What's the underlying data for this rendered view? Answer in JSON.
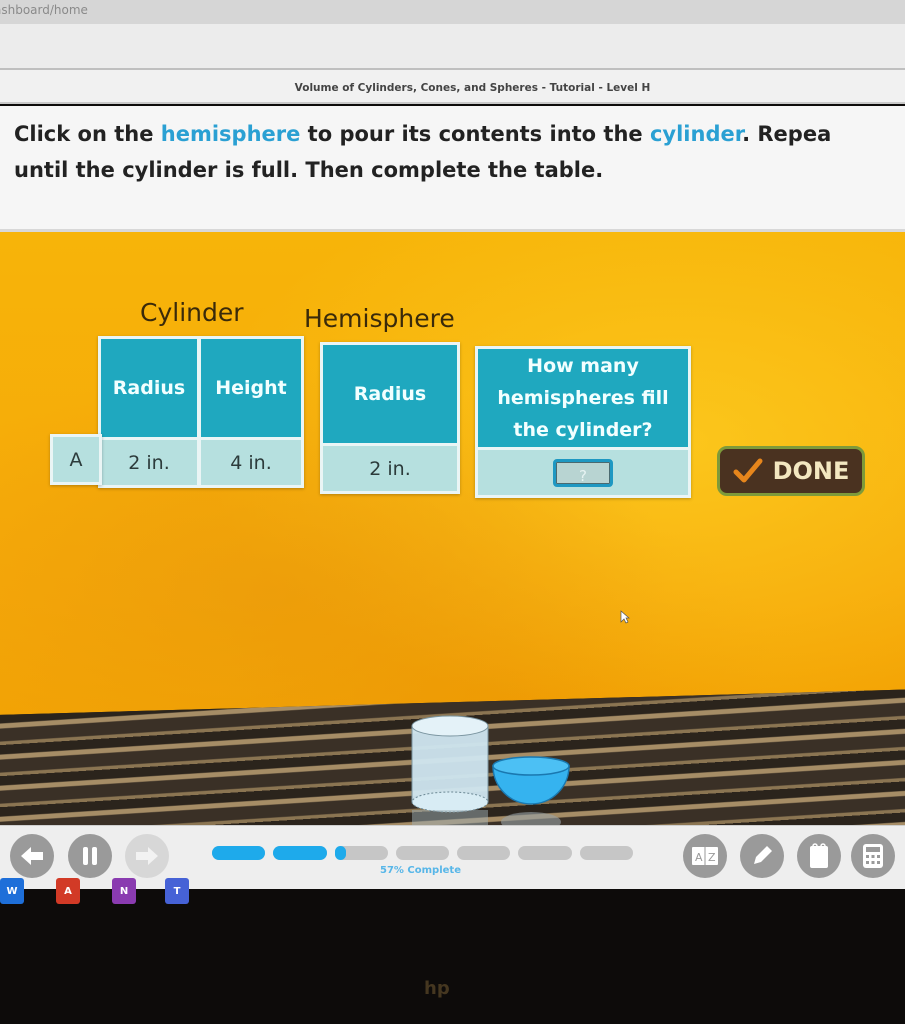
{
  "browser": {
    "url_fragment": "ashboard/home"
  },
  "lesson": {
    "title": "Volume of Cylinders, Cones, and Spheres - Tutorial - Level H"
  },
  "instructions": {
    "line1_part1": "Click on the ",
    "line1_hl1": "hemisphere",
    "line1_part2": " to pour its contents into the ",
    "line1_hl2": "cylinder",
    "line1_part3": ". Repea",
    "line2": "until the cylinder is full. Then complete the table.",
    "highlight_color": "#2aa0d3"
  },
  "table": {
    "group_labels": {
      "cylinder": "Cylinder",
      "hemisphere": "Hemisphere"
    },
    "headers": {
      "cyl_radius": "Radius",
      "cyl_height": "Height",
      "hemi_radius": "Radius",
      "how_many": "How many hemispheres fill the cylinder?"
    },
    "rows": [
      {
        "label": "A",
        "cyl_radius": "2 in.",
        "cyl_height": "4 in.",
        "hemi_radius": "2 in.",
        "answer_placeholder": "?"
      }
    ],
    "header_color": "#1fa8bf",
    "cell_color": "#b6e0df"
  },
  "done_button": {
    "label": "DONE",
    "icon": "checkmark-icon"
  },
  "scene": {
    "objects": [
      "cylinder",
      "hemisphere"
    ],
    "hemisphere_color": "#35b3ef",
    "cylinder_color": "#cfe6f0"
  },
  "bottom_bar": {
    "buttons": [
      {
        "name": "back",
        "icon": "arrow-left-icon",
        "enabled": true
      },
      {
        "name": "pause",
        "icon": "pause-icon",
        "enabled": true
      },
      {
        "name": "forward",
        "icon": "arrow-right-icon",
        "enabled": false
      }
    ],
    "progress": {
      "percent": 57,
      "label": "57% Complete",
      "segments": 7,
      "fill_color": "#1eaaeb"
    },
    "tools": [
      {
        "name": "glossary",
        "icon": "glossary-az-icon"
      },
      {
        "name": "highlighter",
        "icon": "pencil-icon"
      },
      {
        "name": "notepad",
        "icon": "notepad-icon"
      },
      {
        "name": "calculator",
        "icon": "calculator-icon"
      }
    ]
  },
  "taskbar": {
    "apps": [
      {
        "name": "Word",
        "glyph": "W",
        "color": "#1e6fd9"
      },
      {
        "name": "Acrobat",
        "glyph": "A",
        "color": "#d23a26"
      },
      {
        "name": "OneNote",
        "glyph": "N",
        "color": "#8a3bb0"
      },
      {
        "name": "Teams",
        "glyph": "T",
        "color": "#4662d6"
      }
    ]
  },
  "bezel": {
    "brand": "hp"
  }
}
